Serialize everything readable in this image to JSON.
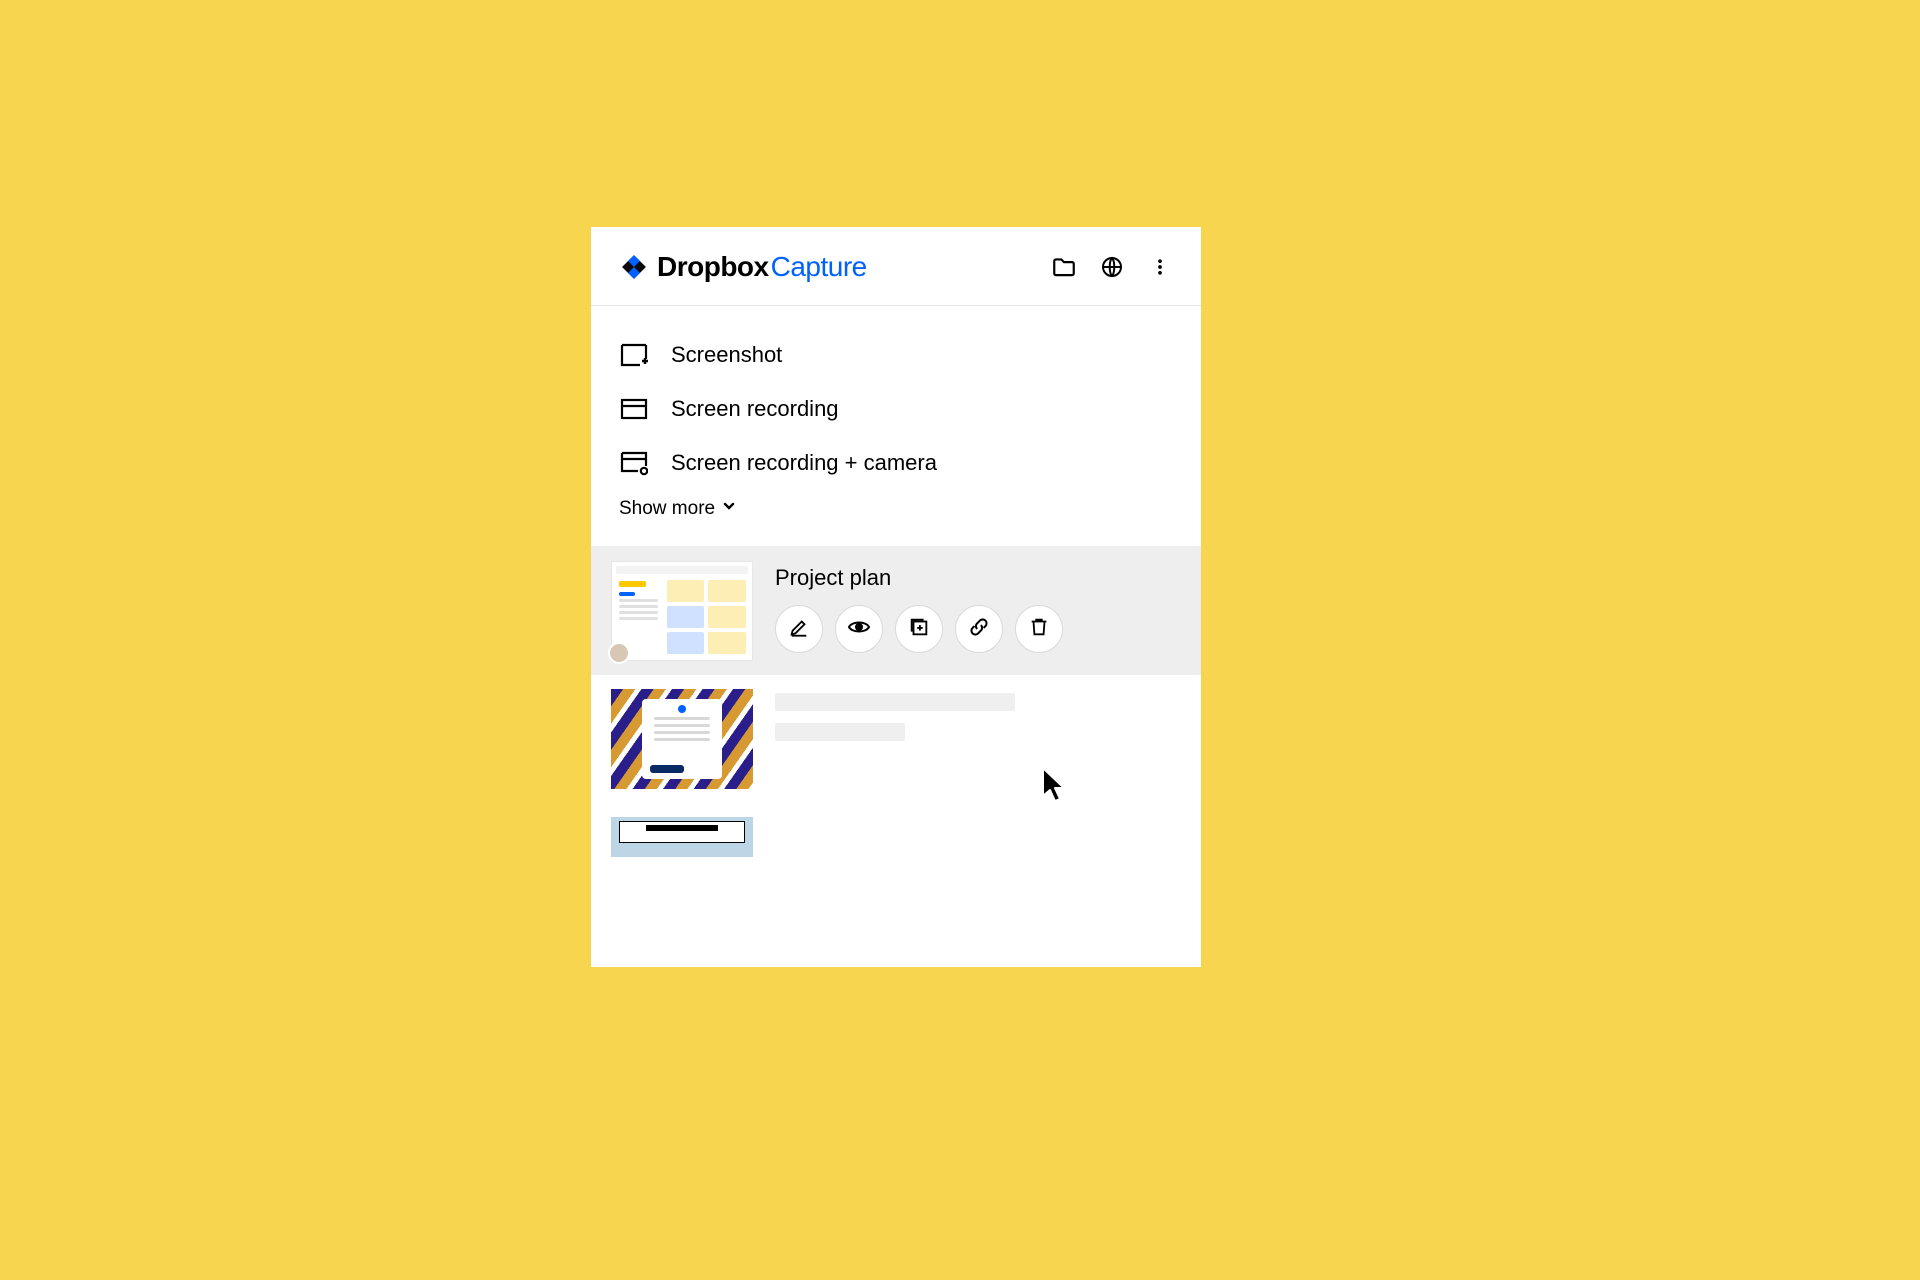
{
  "header": {
    "brand_primary": "Dropbox",
    "brand_secondary": "Capture"
  },
  "options": [
    {
      "label": "Screenshot"
    },
    {
      "label": "Screen recording"
    },
    {
      "label": "Screen recording + camera"
    }
  ],
  "show_more_label": "Show more",
  "captures": [
    {
      "title": "Project plan"
    }
  ],
  "colors": {
    "accent": "#0061fe",
    "background": "#f7d54e"
  }
}
